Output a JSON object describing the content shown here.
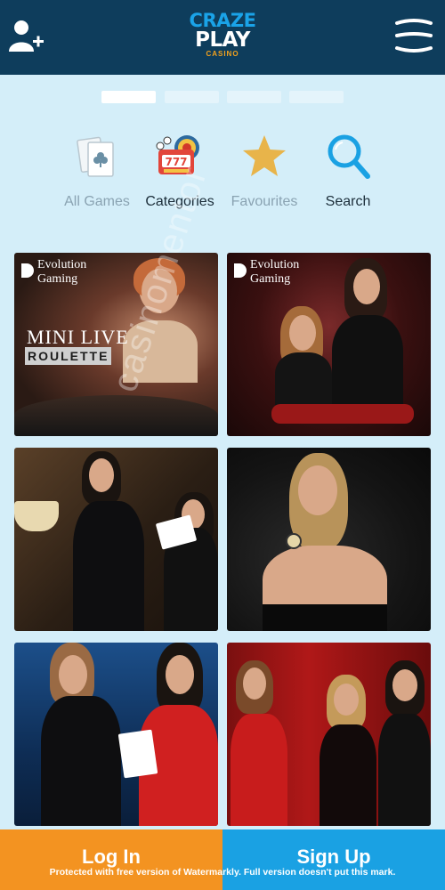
{
  "header": {
    "logo_line1": "CRAZE",
    "logo_line2": "PLAY",
    "logo_line3": "CASINO",
    "user_icon": "add-user-icon",
    "menu_icon": "hamburger-menu-icon"
  },
  "carousel": {
    "count": 4,
    "active_index": 0
  },
  "tabs": [
    {
      "label": "All Games",
      "icon": "cards-icon"
    },
    {
      "label": "Categories",
      "icon": "slot-machine-icon"
    },
    {
      "label": "Favourites",
      "icon": "star-icon"
    },
    {
      "label": "Search",
      "icon": "search-icon"
    }
  ],
  "tiles": [
    {
      "provider_line1": "Evolution",
      "provider_line2": "Gaming",
      "title_line1": "MINI LIVE",
      "title_line2": "ROULETTE"
    },
    {
      "provider_line1": "Evolution",
      "provider_line2": "Gaming"
    },
    {},
    {},
    {},
    {}
  ],
  "footer": {
    "login_label": "Log In",
    "signup_label": "Sign Up",
    "watermark": "Protected with free version of Watermarkly. Full version doesn't put this mark."
  },
  "overlay_text": "casinomentor",
  "colors": {
    "header_bg": "#0e3d5c",
    "page_bg": "#d4eef9",
    "login": "#f39321",
    "signup": "#1aa1e3"
  }
}
